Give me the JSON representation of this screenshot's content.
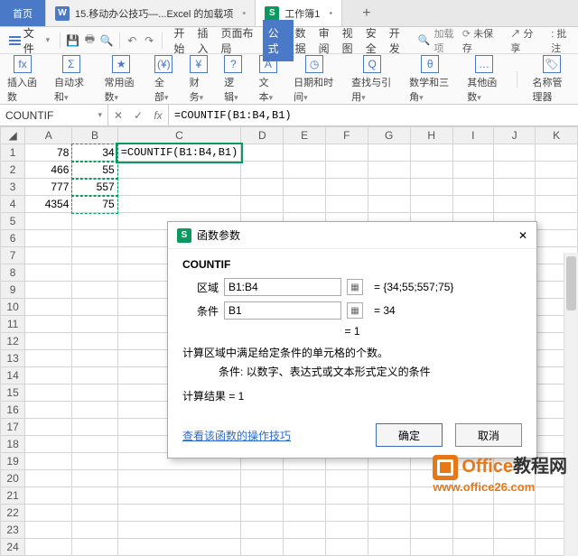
{
  "tabs": {
    "home": "首页",
    "doc": "15.移动办公技巧—...Excel 的加载项",
    "sheet": "工作簿1"
  },
  "menu": {
    "file": "文件"
  },
  "ribbon": {
    "start": "开始",
    "insert": "插入",
    "layout": "页面布局",
    "formula": "公式",
    "data": "数据",
    "review": "审阅",
    "view": "视图",
    "security": "安全",
    "dev": "开发",
    "search_placeholder": "加载项",
    "unsaved": "未保存",
    "share": "分享",
    "batch": "批注"
  },
  "formula_groups": {
    "insert_fn": "插入函数",
    "autosum": "自动求和",
    "common": "常用函数",
    "all": "全部",
    "finance": "财务",
    "logic": "逻辑",
    "text": "文本",
    "datetime": "日期和时间",
    "lookup": "查找与引用",
    "math": "数学和三角",
    "other": "其他函数",
    "name_mgr": "名称管理器"
  },
  "fx": {
    "name_box": "COUNTIF",
    "formula": "=COUNTIF(B1:B4,B1)"
  },
  "sheet": {
    "cols": [
      "A",
      "B",
      "C",
      "D",
      "E",
      "F",
      "G",
      "H",
      "I",
      "J",
      "K"
    ],
    "rows": [
      {
        "n": "1",
        "A": "78",
        "B": "34",
        "C": "=COUNTIF(B1:B4,B1)"
      },
      {
        "n": "2",
        "A": "466",
        "B": "55"
      },
      {
        "n": "3",
        "A": "777",
        "B": "557"
      },
      {
        "n": "4",
        "A": "4354",
        "B": "75"
      }
    ],
    "row_count": 24
  },
  "dialog": {
    "title": "函数参数",
    "fn": "COUNTIF",
    "params": [
      {
        "label": "区域",
        "value": "B1:B4",
        "result": "= {34;55;557;75}"
      },
      {
        "label": "条件",
        "value": "B1",
        "result": "= 34"
      }
    ],
    "mid_result": "= 1",
    "desc": "计算区域中满足给定条件的单元格的个数。",
    "desc_sub": "条件: 以数字、表达式或文本形式定义的条件",
    "calc_result": "计算结果 = 1",
    "help_link": "查看该函数的操作技巧",
    "ok": "确定",
    "cancel": "取消"
  },
  "watermark": {
    "line1a": "Office",
    "line1b": "教程网",
    "line2": "www.office26.com"
  }
}
